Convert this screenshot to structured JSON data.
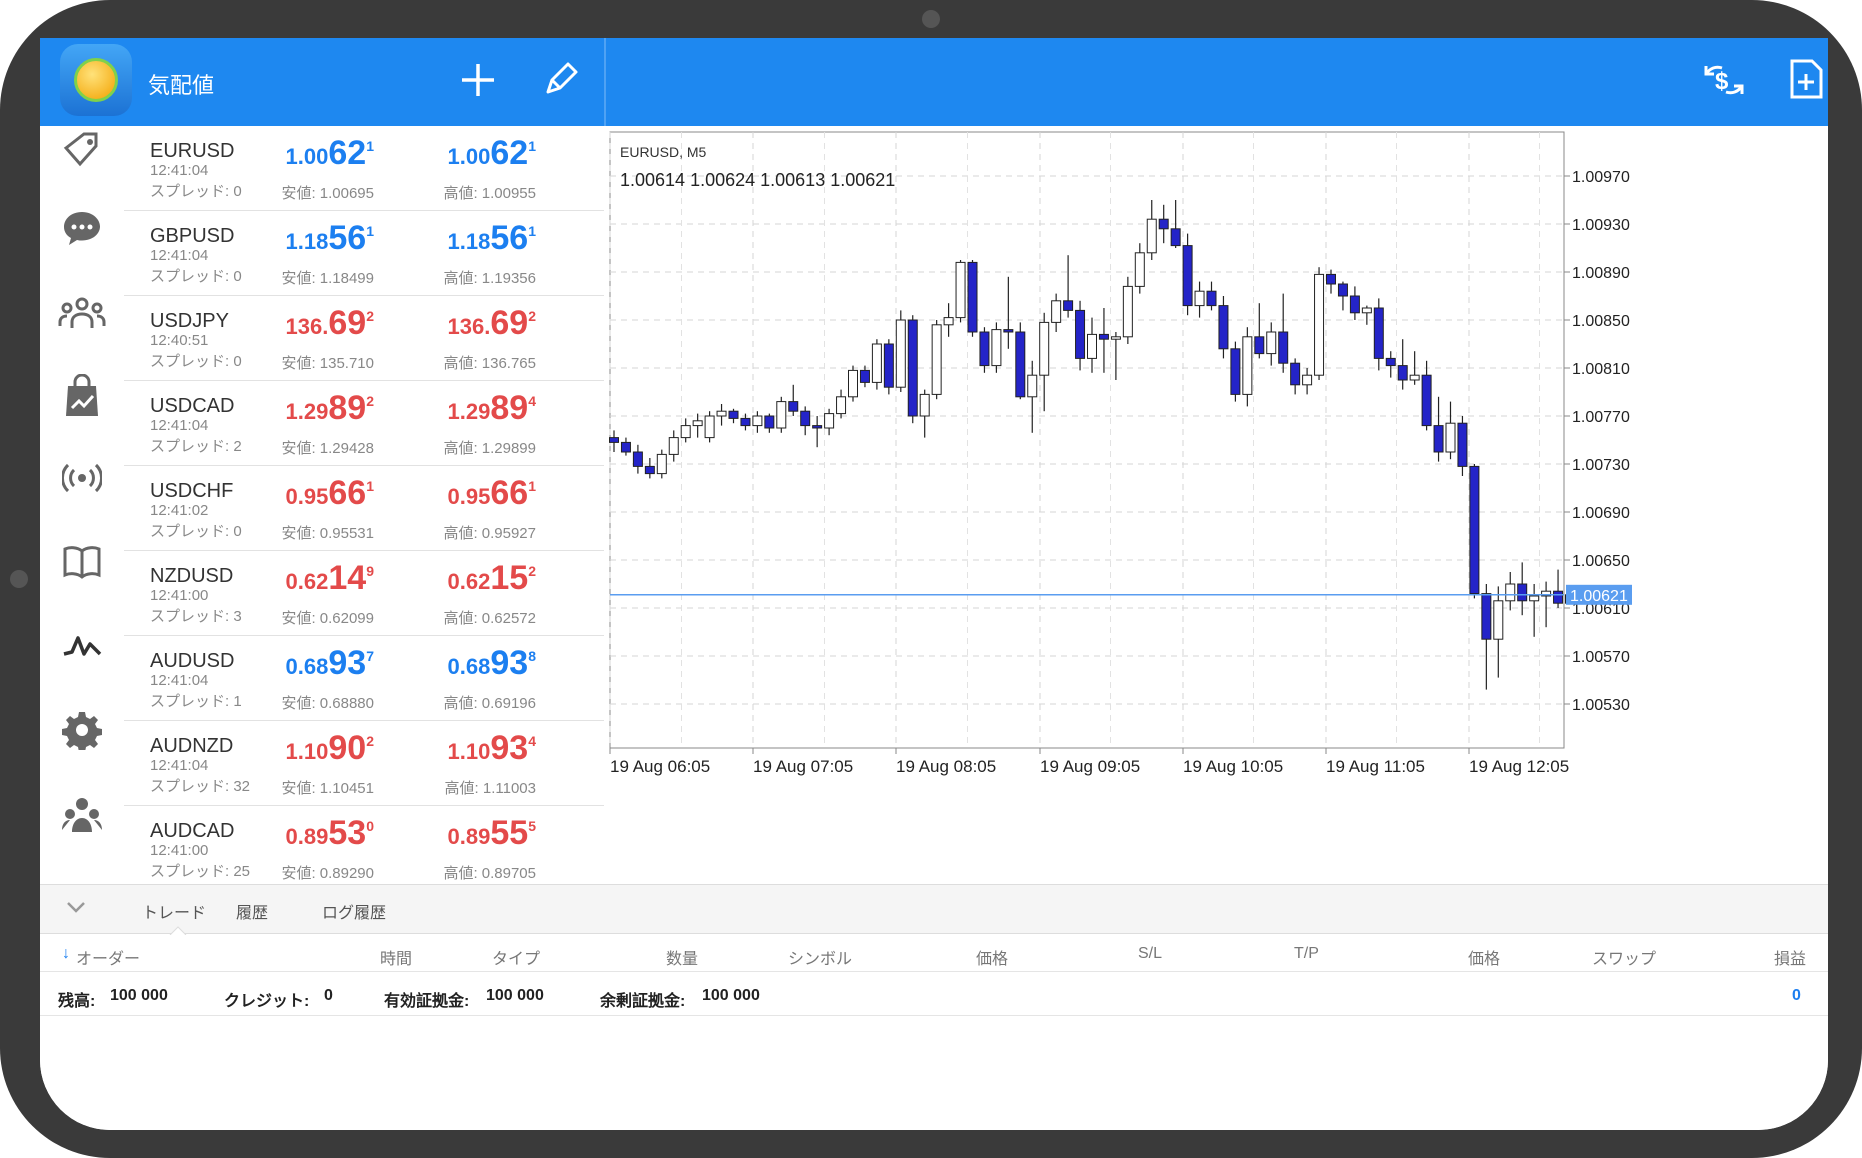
{
  "app": {
    "title": "気配値"
  },
  "quotes": [
    {
      "symbol": "EURUSD",
      "time": "12:41:04",
      "spread": "スプレッド: 0",
      "bid_small": "1.00",
      "bid_big": "62",
      "bid_sup": "1",
      "ask_small": "1.00",
      "ask_big": "62",
      "ask_sup": "1",
      "low": "安値: 1.00695",
      "high": "高値: 1.00955",
      "color": "blue"
    },
    {
      "symbol": "GBPUSD",
      "time": "12:41:04",
      "spread": "スプレッド: 0",
      "bid_small": "1.18",
      "bid_big": "56",
      "bid_sup": "1",
      "ask_small": "1.18",
      "ask_big": "56",
      "ask_sup": "1",
      "low": "安値: 1.18499",
      "high": "高値: 1.19356",
      "color": "blue"
    },
    {
      "symbol": "USDJPY",
      "time": "12:40:51",
      "spread": "スプレッド: 0",
      "bid_small": "136.",
      "bid_big": "69",
      "bid_sup": "2",
      "ask_small": "136.",
      "ask_big": "69",
      "ask_sup": "2",
      "low": "安値: 135.710",
      "high": "高値: 136.765",
      "color": "red"
    },
    {
      "symbol": "USDCAD",
      "time": "12:41:04",
      "spread": "スプレッド: 2",
      "bid_small": "1.29",
      "bid_big": "89",
      "bid_sup": "2",
      "ask_small": "1.29",
      "ask_big": "89",
      "ask_sup": "4",
      "low": "安値: 1.29428",
      "high": "高値: 1.29899",
      "color": "red"
    },
    {
      "symbol": "USDCHF",
      "time": "12:41:02",
      "spread": "スプレッド: 0",
      "bid_small": "0.95",
      "bid_big": "66",
      "bid_sup": "1",
      "ask_small": "0.95",
      "ask_big": "66",
      "ask_sup": "1",
      "low": "安値: 0.95531",
      "high": "高値: 0.95927",
      "color": "red"
    },
    {
      "symbol": "NZDUSD",
      "time": "12:41:00",
      "spread": "スプレッド: 3",
      "bid_small": "0.62",
      "bid_big": "14",
      "bid_sup": "9",
      "ask_small": "0.62",
      "ask_big": "15",
      "ask_sup": "2",
      "low": "安値: 0.62099",
      "high": "高値: 0.62572",
      "color": "red"
    },
    {
      "symbol": "AUDUSD",
      "time": "12:41:04",
      "spread": "スプレッド: 1",
      "bid_small": "0.68",
      "bid_big": "93",
      "bid_sup": "7",
      "ask_small": "0.68",
      "ask_big": "93",
      "ask_sup": "8",
      "low": "安値: 0.68880",
      "high": "高値: 0.69196",
      "color": "blue"
    },
    {
      "symbol": "AUDNZD",
      "time": "12:41:04",
      "spread": "スプレッド: 32",
      "bid_small": "1.10",
      "bid_big": "90",
      "bid_sup": "2",
      "ask_small": "1.10",
      "ask_big": "93",
      "ask_sup": "4",
      "low": "安値: 1.10451",
      "high": "高値: 1.11003",
      "color": "red"
    },
    {
      "symbol": "AUDCAD",
      "time": "12:41:00",
      "spread": "スプレッド: 25",
      "bid_small": "0.89",
      "bid_big": "53",
      "bid_sup": "0",
      "ask_small": "0.89",
      "ask_big": "55",
      "ask_sup": "5",
      "low": "安値: 0.89290",
      "high": "高値: 0.89705",
      "color": "red"
    }
  ],
  "chart": {
    "label": "EURUSD, M5",
    "ohlc": "1.00614 1.00624 1.00613 1.00621",
    "current_price": "1.00621"
  },
  "chart_data": {
    "type": "candlestick",
    "symbol": "EURUSD",
    "timeframe": "M5",
    "ylim": [
      1.005,
      1.01
    ],
    "y_ticks": [
      "1.00970",
      "1.00930",
      "1.00890",
      "1.00850",
      "1.00810",
      "1.00770",
      "1.00730",
      "1.00690",
      "1.00650",
      "1.00610",
      "1.00570",
      "1.00530"
    ],
    "x_ticks": [
      "19 Aug 06:05",
      "19 Aug 07:05",
      "19 Aug 08:05",
      "19 Aug 09:05",
      "19 Aug 10:05",
      "19 Aug 11:05",
      "19 Aug 12:05"
    ],
    "current_price": 1.00621,
    "candles": [
      [
        1.00752,
        1.00758,
        1.0074,
        1.00748
      ],
      [
        1.00748,
        1.00752,
        1.00737,
        1.0074
      ],
      [
        1.0074,
        1.00746,
        1.00722,
        1.00728
      ],
      [
        1.00728,
        1.00735,
        1.00718,
        1.00722
      ],
      [
        1.00722,
        1.00742,
        1.00718,
        1.00738
      ],
      [
        1.00738,
        1.00758,
        1.00732,
        1.00752
      ],
      [
        1.00752,
        1.00768,
        1.00748,
        1.00762
      ],
      [
        1.00762,
        1.00772,
        1.00752,
        1.00766
      ],
      [
        1.00752,
        1.00774,
        1.00748,
        1.0077
      ],
      [
        1.0077,
        1.0078,
        1.00762,
        1.00774
      ],
      [
        1.00774,
        1.00776,
        1.00764,
        1.00768
      ],
      [
        1.00768,
        1.00772,
        1.00758,
        1.00762
      ],
      [
        1.00762,
        1.00774,
        1.00756,
        1.0077
      ],
      [
        1.0077,
        1.00772,
        1.00756,
        1.0076
      ],
      [
        1.0076,
        1.00786,
        1.00756,
        1.00782
      ],
      [
        1.00782,
        1.00796,
        1.0077,
        1.00774
      ],
      [
        1.00774,
        1.00778,
        1.00754,
        1.00762
      ],
      [
        1.00762,
        1.0077,
        1.00744,
        1.0076
      ],
      [
        1.0076,
        1.00776,
        1.00754,
        1.00772
      ],
      [
        1.00772,
        1.00792,
        1.00768,
        1.00786
      ],
      [
        1.00786,
        1.00812,
        1.00782,
        1.00808
      ],
      [
        1.00808,
        1.00812,
        1.00794,
        1.00798
      ],
      [
        1.00798,
        1.00834,
        1.00792,
        1.0083
      ],
      [
        1.0083,
        1.00834,
        1.00788,
        1.00794
      ],
      [
        1.00794,
        1.00858,
        1.0079,
        1.0085
      ],
      [
        1.0085,
        1.00854,
        1.00764,
        1.0077
      ],
      [
        1.0077,
        1.00792,
        1.00752,
        1.00788
      ],
      [
        1.00788,
        1.0085,
        1.00784,
        1.00846
      ],
      [
        1.00846,
        1.00864,
        1.00836,
        1.00852
      ],
      [
        1.00852,
        1.009,
        1.00848,
        1.00898
      ],
      [
        1.00898,
        1.009,
        1.00836,
        1.0084
      ],
      [
        1.0084,
        1.00844,
        1.00806,
        1.00812
      ],
      [
        1.00812,
        1.00848,
        1.00806,
        1.00842
      ],
      [
        1.00842,
        1.00886,
        1.00826,
        1.0084
      ],
      [
        1.0084,
        1.00848,
        1.00784,
        1.00786
      ],
      [
        1.00786,
        1.00816,
        1.00756,
        1.00804
      ],
      [
        1.00804,
        1.00856,
        1.00774,
        1.00848
      ],
      [
        1.00848,
        1.00872,
        1.0084,
        1.00866
      ],
      [
        1.00866,
        1.00904,
        1.00852,
        1.00858
      ],
      [
        1.00858,
        1.00866,
        1.00808,
        1.00818
      ],
      [
        1.00818,
        1.00852,
        1.00806,
        1.00838
      ],
      [
        1.00838,
        1.0086,
        1.00806,
        1.00834
      ],
      [
        1.00834,
        1.0084,
        1.008,
        1.00836
      ],
      [
        1.00836,
        1.00886,
        1.0083,
        1.00878
      ],
      [
        1.00878,
        1.00914,
        1.00872,
        1.00906
      ],
      [
        1.00906,
        1.0095,
        1.009,
        1.00934
      ],
      [
        1.00934,
        1.00946,
        1.00914,
        1.00926
      ],
      [
        1.00926,
        1.0095,
        1.0091,
        1.00912
      ],
      [
        1.00912,
        1.00922,
        1.00854,
        1.00862
      ],
      [
        1.00862,
        1.00882,
        1.00852,
        1.00874
      ],
      [
        1.00874,
        1.00882,
        1.00858,
        1.00862
      ],
      [
        1.00862,
        1.0087,
        1.00818,
        1.00826
      ],
      [
        1.00826,
        1.00832,
        1.00782,
        1.00788
      ],
      [
        1.00788,
        1.00844,
        1.00778,
        1.00836
      ],
      [
        1.00836,
        1.00864,
        1.00818,
        1.00822
      ],
      [
        1.00822,
        1.00848,
        1.00812,
        1.0084
      ],
      [
        1.0084,
        1.00872,
        1.00806,
        1.00814
      ],
      [
        1.00814,
        1.00818,
        1.00788,
        1.00796
      ],
      [
        1.00796,
        1.0081,
        1.00788,
        1.00804
      ],
      [
        1.00804,
        1.00894,
        1.008,
        1.00888
      ],
      [
        1.00888,
        1.00892,
        1.00872,
        1.0088
      ],
      [
        1.0088,
        1.00882,
        1.00858,
        1.0087
      ],
      [
        1.0087,
        1.00878,
        1.0085,
        1.00856
      ],
      [
        1.00856,
        1.00862,
        1.00846,
        1.0086
      ],
      [
        1.0086,
        1.00868,
        1.00808,
        1.00818
      ],
      [
        1.00818,
        1.00824,
        1.00802,
        1.00812
      ],
      [
        1.00812,
        1.00834,
        1.00792,
        1.008
      ],
      [
        1.008,
        1.00824,
        1.00796,
        1.00804
      ],
      [
        1.00804,
        1.00816,
        1.00758,
        1.00762
      ],
      [
        1.00762,
        1.00786,
        1.00732,
        1.0074
      ],
      [
        1.0074,
        1.00782,
        1.00734,
        1.00764
      ],
      [
        1.00764,
        1.0077,
        1.0072,
        1.00728
      ],
      [
        1.00728,
        1.0073,
        1.00618,
        1.00622
      ],
      [
        1.00622,
        1.0063,
        1.00542,
        1.00584
      ],
      [
        1.00584,
        1.00628,
        1.00552,
        1.00616
      ],
      [
        1.00616,
        1.0064,
        1.00608,
        1.0063
      ],
      [
        1.0063,
        1.00648,
        1.00604,
        1.00616
      ],
      [
        1.00616,
        1.0063,
        1.00586,
        1.0062
      ],
      [
        1.0062,
        1.00632,
        1.00594,
        1.00624
      ],
      [
        1.00624,
        1.00642,
        1.0061,
        1.00614
      ],
      [
        1.00614,
        1.00624,
        1.00613,
        1.00621
      ]
    ]
  },
  "bottom": {
    "tabs": [
      "トレード",
      "履歴",
      "ログ履歴"
    ],
    "columns": [
      "オーダー",
      "時間",
      "タイプ",
      "数量",
      "シンボル",
      "価格",
      "S/L",
      "T/P",
      "価格",
      "スワップ",
      "損益"
    ],
    "account": {
      "balance_label": "残高:",
      "balance": "100 000",
      "credit_label": "クレジット:",
      "credit": "0",
      "equity_label": "有効証拠金:",
      "equity": "100 000",
      "free_label": "余剰証拠金:",
      "free": "100 000",
      "profit": "0"
    }
  },
  "colors": {
    "accent": "#1e88f0",
    "bull": "#ffffff",
    "bear": "#2424c8",
    "price_up": "#1c7ff0",
    "price_down": "#e34a4a"
  },
  "icons": [
    "plus-icon",
    "pencil-icon",
    "currency-exchange-icon",
    "new-document-icon",
    "tag-icon",
    "chat-icon",
    "community-icon",
    "market-icon",
    "signal-icon",
    "book-icon",
    "chart-icon",
    "settings-icon",
    "users-icon",
    "chevron-down-icon",
    "sort-arrow-icon"
  ]
}
